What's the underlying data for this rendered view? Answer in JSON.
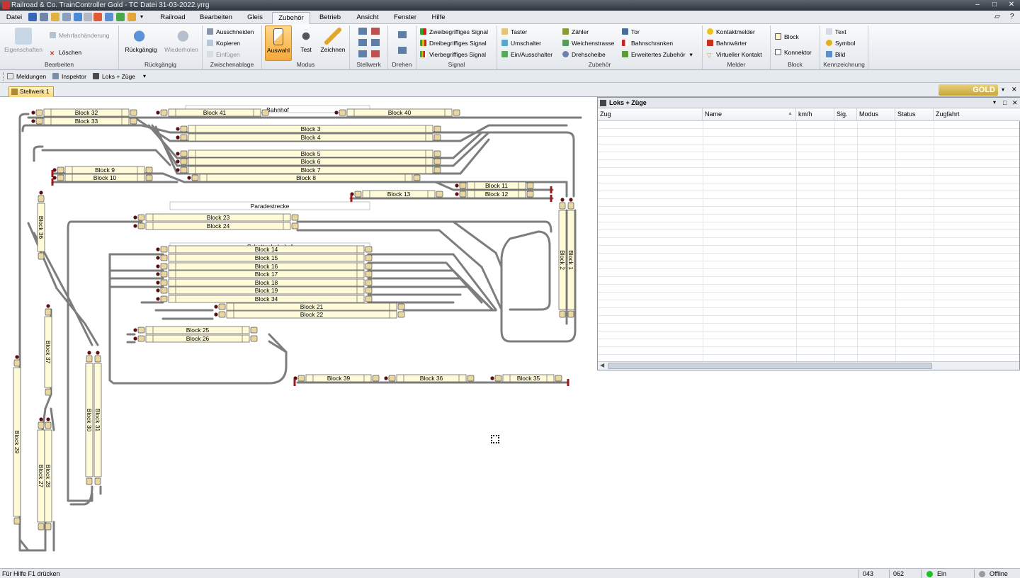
{
  "window": {
    "title": "Railroad & Co. TrainController Gold - TC Datei 31-03-2022.yrrg"
  },
  "menu": {
    "file": "Datei",
    "tabs": [
      "Railroad",
      "Bearbeiten",
      "Gleis",
      "Zubehör",
      "Betrieb",
      "Ansicht",
      "Fenster",
      "Hilfe"
    ],
    "active": "Zubehör"
  },
  "ribbon": {
    "bearbeiten": {
      "label": "Bearbeiten",
      "eigenschaften": "Eigenschaften",
      "mehrfach": "Mehrfachänderung",
      "loeschen": "Löschen"
    },
    "rueckgaengig": {
      "label": "Rückgängig",
      "undo": "Rückgängig",
      "redo": "Wiederholen"
    },
    "zwischenablage": {
      "label": "Zwischenablage",
      "cut": "Ausschneiden",
      "copy": "Kopieren",
      "paste": "Einfügen"
    },
    "modus": {
      "label": "Modus",
      "auswahl": "Auswahl",
      "test": "Test",
      "zeichnen": "Zeichnen"
    },
    "stellwerk": {
      "label": "Stellwerk"
    },
    "drehen": {
      "label": "Drehen"
    },
    "signal": {
      "label": "Signal",
      "s2": "Zweibegriffiges Signal",
      "s3": "Dreibegriffiges Signal",
      "s4": "Vierbegriffiges Signal"
    },
    "zubehoer": {
      "label": "Zubehör",
      "taster": "Taster",
      "umschalter": "Umschalter",
      "einaus": "Ein/Ausschalter",
      "zaehler": "Zähler",
      "weichenstrasse": "Weichenstrasse",
      "drehscheibe": "Drehscheibe",
      "tor": "Tor",
      "bahnschranken": "Bahnschranken",
      "erweitert": "Erweitertes Zubehör"
    },
    "melder": {
      "label": "Melder",
      "kontaktmelder": "Kontaktmelder",
      "bahnwaerter": "Bahnwärter",
      "virtuell": "Virtueller Kontakt"
    },
    "block": {
      "label": "Block",
      "block": "Block",
      "konnektor": "Konnektor"
    },
    "kennzeichnung": {
      "label": "Kennzeichnung",
      "text": "Text",
      "symbol": "Symbol",
      "bild": "Bild"
    }
  },
  "toolbar2": {
    "meldungen": "Meldungen",
    "inspektor": "Inspektor",
    "loks": "Loks + Züge"
  },
  "doc_tab": "Stellwerk 1",
  "gold_label": "GOLD",
  "panel": {
    "title": "Loks + Züge",
    "columns": [
      "Zug",
      "Name",
      "km/h",
      "Sig.",
      "Modus",
      "Status",
      "Zugfahrt"
    ]
  },
  "status": {
    "help": "Für Hilfe F1 drücken",
    "c1": "043",
    "c2": "062",
    "ein": "Ein",
    "offline": "Offline",
    "ein_color": "#1fbf2a",
    "offline_color": "#9a9a9a"
  },
  "layout": {
    "labels": {
      "bahnhof": "Bahnhof",
      "paradestrecke": "Paradestrecke",
      "schattenbahnhof": "Schattenbahnhof"
    },
    "blocks": {
      "b32": "Block 32",
      "b33": "Block 33",
      "b41": "Block 41",
      "b40": "Block 40",
      "b3": "Block 3",
      "b4": "Block 4",
      "b5": "Block 5",
      "b6": "Block 6",
      "b7": "Block 7",
      "b8": "Block 8",
      "b9": "Block 9",
      "b10": "Block 10",
      "b11": "Block 11",
      "b12": "Block 12",
      "b13": "Block 13",
      "b23": "Block 23",
      "b24": "Block 24",
      "b14": "Block 14",
      "b15": "Block 15",
      "b16": "Block 16",
      "b17": "Block 17",
      "b18": "Block 18",
      "b19": "Block 19",
      "b34": "Block 34",
      "b21": "Block 21",
      "b22": "Block 22",
      "b25": "Block 25",
      "b26": "Block 26",
      "b39": "Block 39",
      "b36h": "Block 36",
      "b35": "Block 35",
      "b36v": "Block 36",
      "b37": "Block 37",
      "b29": "Block 29",
      "b27": "Block 27",
      "b28": "Block 28",
      "b30": "Block 30",
      "b31": "Block 31",
      "b1": "Block 1",
      "b2": "Block 2"
    }
  }
}
